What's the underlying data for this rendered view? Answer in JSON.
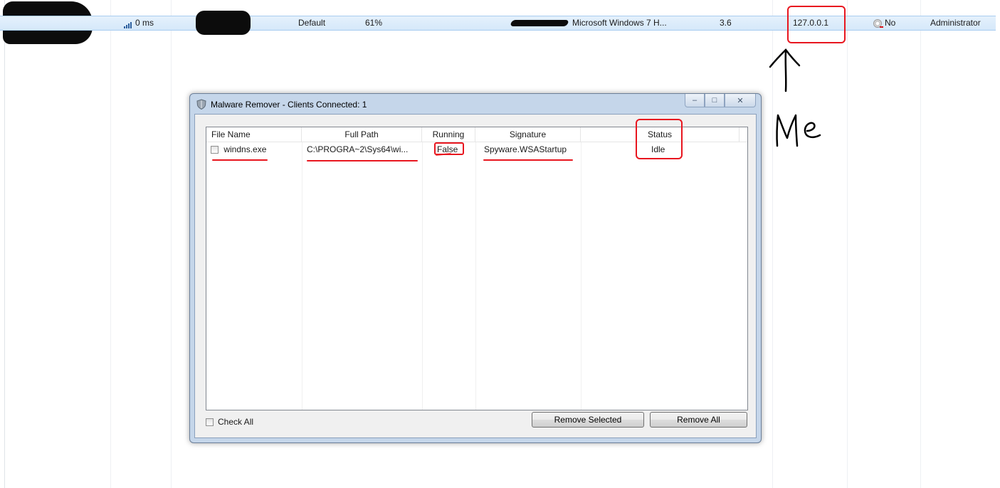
{
  "client_row": {
    "ping": "0 ms",
    "group": "Default",
    "percent": "61%",
    "os": "Microsoft Windows 7 H...",
    "version": "3.6",
    "ip": "127.0.0.1",
    "webcam": "No",
    "account_type": "Administrator"
  },
  "annotation": {
    "me_text": "Me"
  },
  "dialog": {
    "title": "Malware Remover - Clients Connected: 1",
    "caption": {
      "minimize": "–",
      "maximize": "□",
      "close": "✕"
    },
    "columns": [
      "File Name",
      "Full Path",
      "Running",
      "Signature",
      "Status"
    ],
    "rows": [
      {
        "file_name": "windns.exe",
        "full_path": "C:\\PROGRA~2\\Sys64\\wi...",
        "running": "False",
        "signature": "Spyware.WSAStartup",
        "status": "Idle"
      }
    ],
    "check_all_label": "Check All",
    "remove_selected_label": "Remove Selected",
    "remove_all_label": "Remove All"
  },
  "colors": {
    "annotation_red": "#e8161f",
    "row_highlight": "#d5e8fa",
    "dialog_frame": "#c5d6ea"
  }
}
